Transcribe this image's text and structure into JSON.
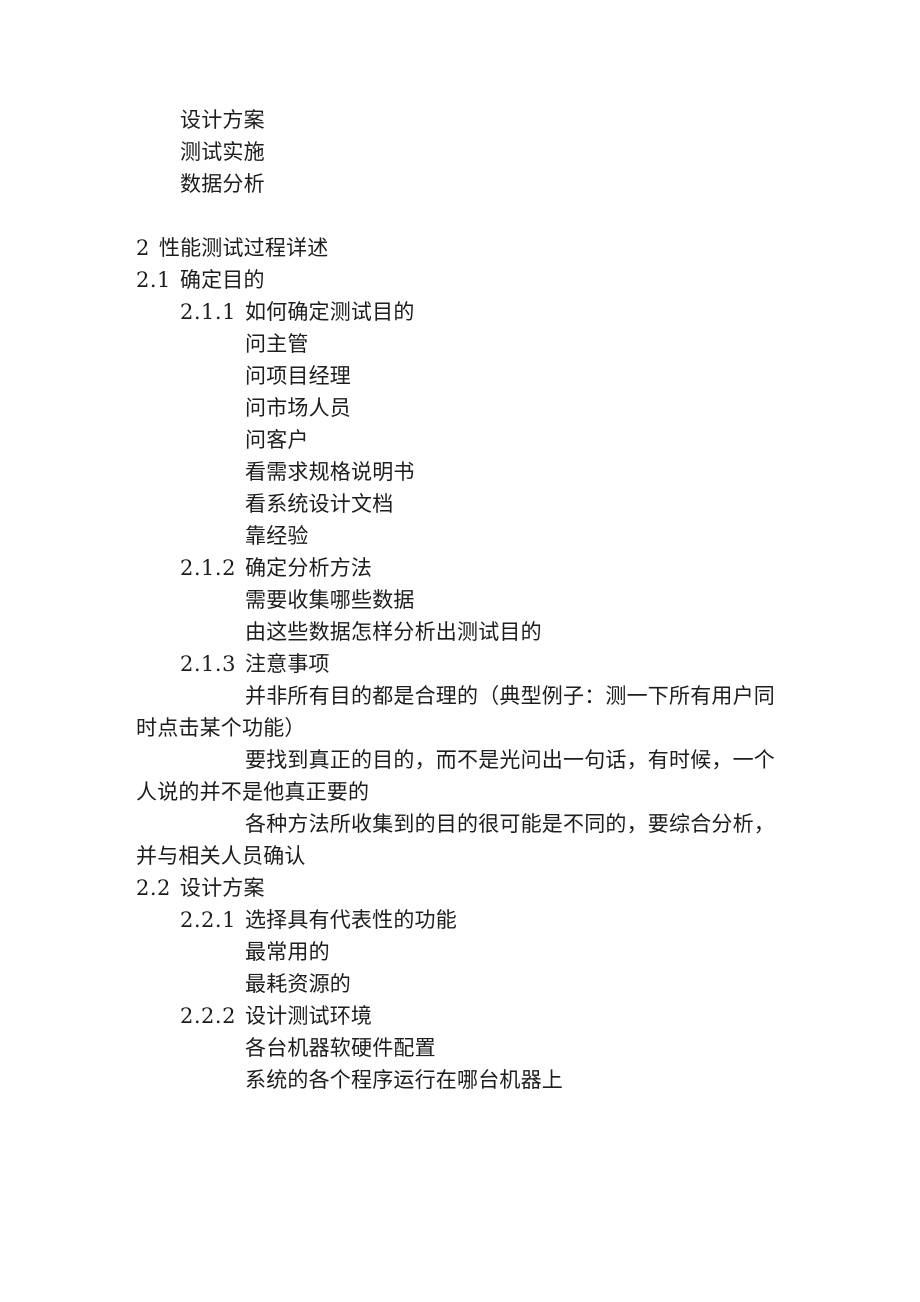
{
  "document": {
    "blocks": [
      {
        "kind": "item",
        "level": 1,
        "text": "设计方案"
      },
      {
        "kind": "item",
        "level": 1,
        "text": "测试实施"
      },
      {
        "kind": "item",
        "level": 1,
        "text": "数据分析"
      },
      {
        "kind": "spacer"
      },
      {
        "kind": "heading",
        "level": 0,
        "number": "2",
        "text": "性能测试过程详述"
      },
      {
        "kind": "heading",
        "level": 0,
        "number": "2.1",
        "text": "确定目的"
      },
      {
        "kind": "heading",
        "level": 1,
        "number": "2.1.1",
        "text": "如何确定测试目的"
      },
      {
        "kind": "item",
        "level": 2,
        "text": "问主管"
      },
      {
        "kind": "item",
        "level": 2,
        "text": "问项目经理"
      },
      {
        "kind": "item",
        "level": 2,
        "text": "问市场人员"
      },
      {
        "kind": "item",
        "level": 2,
        "text": "问客户"
      },
      {
        "kind": "item",
        "level": 2,
        "text": "看需求规格说明书"
      },
      {
        "kind": "item",
        "level": 2,
        "text": "看系统设计文档"
      },
      {
        "kind": "item",
        "level": 2,
        "text": "靠经验"
      },
      {
        "kind": "heading",
        "level": 1,
        "number": "2.1.2",
        "text": "确定分析方法"
      },
      {
        "kind": "item",
        "level": 2,
        "text": "需要收集哪些数据"
      },
      {
        "kind": "item",
        "level": 2,
        "text": "由这些数据怎样分析出测试目的"
      },
      {
        "kind": "heading",
        "level": 1,
        "number": "2.1.3",
        "text": "注意事项"
      },
      {
        "kind": "paragraph",
        "text": "并非所有目的都是合理的（典型例子：测一下所有用户同时点击某个功能）"
      },
      {
        "kind": "paragraph",
        "text": "要找到真正的目的，而不是光问出一句话，有时候，一个人说的并不是他真正要的"
      },
      {
        "kind": "paragraph",
        "text": "各种方法所收集到的目的很可能是不同的，要综合分析，并与相关人员确认"
      },
      {
        "kind": "heading",
        "level": 0,
        "number": "2.2",
        "text": "设计方案"
      },
      {
        "kind": "heading",
        "level": 1,
        "number": "2.2.1",
        "text": "选择具有代表性的功能"
      },
      {
        "kind": "item",
        "level": 2,
        "text": "最常用的"
      },
      {
        "kind": "item",
        "level": 2,
        "text": "最耗资源的"
      },
      {
        "kind": "heading",
        "level": 1,
        "number": "2.2.2",
        "text": "设计测试环境"
      },
      {
        "kind": "item",
        "level": 2,
        "text": "各台机器软硬件配置"
      },
      {
        "kind": "item",
        "level": 2,
        "text": "系统的各个程序运行在哪台机器上"
      }
    ]
  }
}
